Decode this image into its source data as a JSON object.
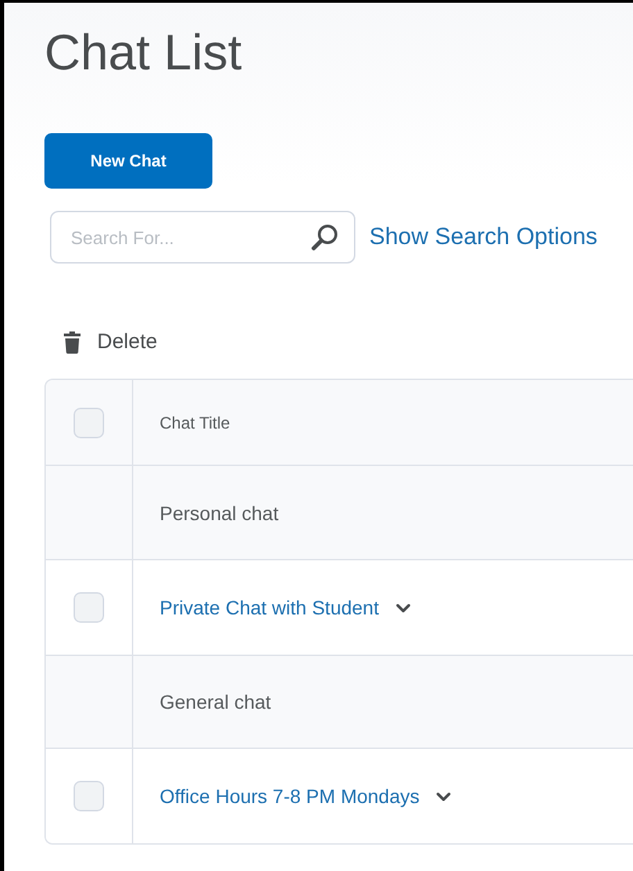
{
  "page": {
    "title": "Chat List"
  },
  "new_button": {
    "label": "New Chat"
  },
  "search": {
    "placeholder": "Search For...",
    "options_link": "Show Search Options"
  },
  "toolbar": {
    "delete": "Delete"
  },
  "table": {
    "header": {
      "label": "Chat Title",
      "checked": false
    },
    "rows": [
      {
        "kind": "group",
        "label": "Personal chat"
      },
      {
        "kind": "item",
        "label": "Private Chat with Student",
        "checked": false
      },
      {
        "kind": "group",
        "label": "General chat"
      },
      {
        "kind": "item",
        "label": "Office Hours 7-8 PM Mondays",
        "checked": false
      }
    ]
  }
}
